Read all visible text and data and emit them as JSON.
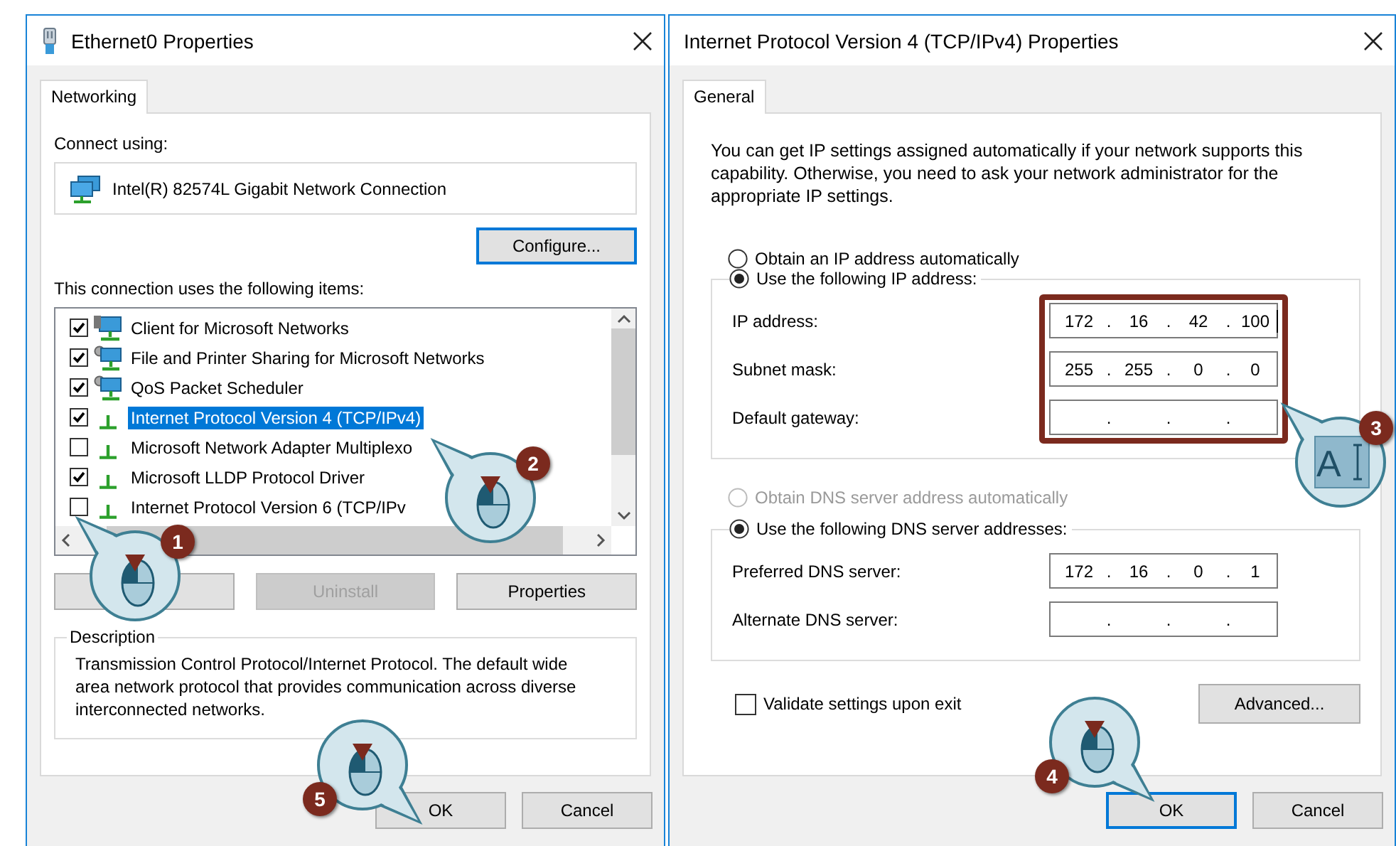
{
  "ethernet_dialog": {
    "title": "Ethernet0 Properties",
    "tabs": [
      {
        "label": "Networking",
        "selected": true
      }
    ],
    "connect_using_label": "Connect using:",
    "adapter": "Intel(R) 82574L Gigabit Network Connection",
    "configure_button": {
      "label": "Configure...",
      "focused": true
    },
    "items_label": "This connection uses the following items:",
    "items": [
      {
        "kind": "client",
        "label": "Client for Microsoft Networks",
        "checked": true,
        "selected": false
      },
      {
        "kind": "service",
        "label": "File and Printer Sharing for Microsoft Networks",
        "checked": true,
        "selected": false
      },
      {
        "kind": "service",
        "label": "QoS Packet Scheduler",
        "checked": true,
        "selected": false
      },
      {
        "kind": "protocol",
        "label": "Internet Protocol Version 4 (TCP/IPv4)",
        "checked": true,
        "selected": true
      },
      {
        "kind": "protocol",
        "label": "Microsoft Network Adapter Multiplexo",
        "checked": false,
        "selected": false
      },
      {
        "kind": "protocol",
        "label": "Microsoft LLDP Protocol Driver",
        "checked": true,
        "selected": false
      },
      {
        "kind": "protocol",
        "label": "Internet Protocol Version 6 (TCP/IPv",
        "checked": false,
        "selected": false
      }
    ],
    "action_buttons": [
      {
        "kind": "covered",
        "disabled": false
      },
      {
        "kind": "labelled",
        "label": "Uninstall",
        "disabled": true
      },
      {
        "kind": "labelled",
        "label": "Properties",
        "disabled": false
      }
    ],
    "description": {
      "title": "Description",
      "text": "Transmission Control Protocol/Internet Protocol. The default wide area network protocol that provides communication across diverse interconnected networks."
    },
    "footer_buttons": [
      {
        "label": "OK",
        "focused": false
      },
      {
        "label": "Cancel",
        "focused": false
      }
    ]
  },
  "ipv4_dialog": {
    "title": "Internet Protocol Version 4 (TCP/IPv4) Properties",
    "tabs": [
      {
        "label": "General",
        "selected": true
      }
    ],
    "intro": "You can get IP settings assigned automatically if your network supports this capability. Otherwise, you need to ask your network administrator for the appropriate IP settings.",
    "ip_options": [
      {
        "label": "Obtain an IP address automatically",
        "selected": false,
        "disabled": false
      },
      {
        "label": "Use the following IP address:",
        "selected": true,
        "disabled": false
      }
    ],
    "ip_group": {
      "highlighted": true,
      "fields": [
        {
          "label": "IP address:",
          "segments": [
            "172",
            ".",
            "16",
            ".",
            "42",
            ".",
            "100"
          ],
          "focused": true
        },
        {
          "label": "Subnet mask:",
          "segments": [
            "255",
            ".",
            "255",
            ".",
            "0",
            ".",
            "0"
          ]
        },
        {
          "label": "Default gateway:",
          "segments": [
            ".",
            ".",
            "."
          ]
        }
      ]
    },
    "dns_options": [
      {
        "label": "Obtain DNS server address automatically",
        "selected": false,
        "disabled": true
      },
      {
        "label": "Use the following DNS server addresses:",
        "selected": true,
        "disabled": false
      }
    ],
    "dns_group": {
      "highlighted": false,
      "fields": [
        {
          "label": "Preferred DNS server:",
          "segments": [
            "172",
            ".",
            "16",
            ".",
            "0",
            ".",
            "1"
          ]
        },
        {
          "label": "Alternate DNS server:",
          "segments": [
            ".",
            ".",
            "."
          ]
        }
      ]
    },
    "validate": {
      "label": "Validate settings upon exit",
      "checked": false
    },
    "advanced_button": {
      "label": "Advanced...",
      "focused": false
    },
    "footer_buttons": [
      {
        "label": "OK",
        "focused": true
      },
      {
        "label": "Cancel",
        "focused": false
      }
    ]
  },
  "callouts": [
    {
      "number": "1",
      "kind": "mouse"
    },
    {
      "number": "2",
      "kind": "mouse"
    },
    {
      "number": "3",
      "kind": "text-cursor",
      "icon_text": "A"
    },
    {
      "number": "4",
      "kind": "mouse"
    },
    {
      "number": "5",
      "kind": "mouse"
    }
  ]
}
